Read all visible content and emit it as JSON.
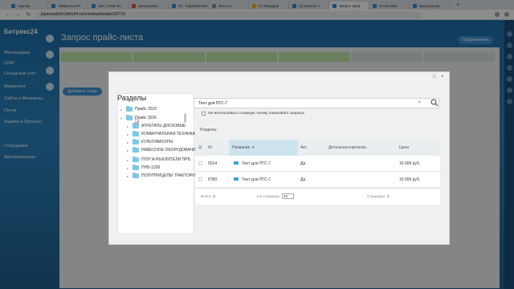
{
  "browser": {
    "tabs": [
      {
        "label": "Сделки",
        "color": "#2f8ad3"
      },
      {
        "label": "Тайвеллы НТ",
        "color": "#2f8ad3"
      },
      {
        "label": "Чат | CRM ИТ",
        "color": "#2f8ad3"
      },
      {
        "label": "www.yandex",
        "color": "#e04d3a"
      },
      {
        "label": "24 · helpdesk.bitrix",
        "color": "#2f8ad3"
      },
      {
        "label": "Фото.ru",
        "color": "#8e8e8e"
      },
      {
        "label": "1С:Предпри",
        "color": "#f0b400"
      },
      {
        "label": "(2) Каталог т",
        "color": "#2f8ad3"
      },
      {
        "label": "Запрос прай",
        "color": "#2f8ad3"
      },
      {
        "label": "Почта Mail",
        "color": "#2f8ad3"
      },
      {
        "label": "Виртуальны",
        "color": "#2f8ad3"
      }
    ],
    "active_tab": 8,
    "new_tab": "+",
    "url": "piyarosalvich.bitrix24.ru/crm/deal/details/16772/"
  },
  "app": {
    "logo": "Битрикс24",
    "menu": [
      "Мессенджер",
      "CRM",
      "Складской учёт",
      "Маркетинг",
      "Сайты и Магазины",
      "Почта",
      "Задачи и Проекты",
      "Сотрудники",
      "Автоматизация"
    ],
    "page_title": "Запрос прайс-листа",
    "add_button": "Добавить товар",
    "right_button": "Предложения"
  },
  "dialog": {
    "sections_title": "Разделы",
    "tree": [
      {
        "label": "Прайс 2023",
        "level": 0,
        "expanded": false
      },
      {
        "label": "Прайс 2026",
        "level": 0,
        "expanded": true
      },
      {
        "label": "АГРЕГАТЫ ДИСКОВЫЕ",
        "level": 1,
        "expanded": false
      },
      {
        "label": "КОММУНАЛЬНАЯ ТЕХНИКА",
        "level": 1,
        "expanded": false
      },
      {
        "label": "КУЛЬТИВАТОРЫ",
        "level": 1,
        "expanded": false
      },
      {
        "label": "НАВЕСНОЕ ОБОРУДОВАНИЕ ДЛЯ",
        "level": 1,
        "expanded": false
      },
      {
        "label": "ПЛУГИ-РЫХЛИТЕЛИ ПРБ",
        "level": 1,
        "expanded": false
      },
      {
        "label": "ПНБ-1200",
        "level": 1,
        "expanded": false
      },
      {
        "label": "ПОЛУПРИЦЕПЫ ТРАКТОРНЫЕ",
        "level": 1,
        "expanded": false
      }
    ],
    "search_value": "Тент для ПГС-7",
    "search_clear": "×",
    "checkbox_label": "Не использовать сложную логику поискового запроса",
    "sections_label": "Разделы:",
    "columns": {
      "id": "ID",
      "name": "Название",
      "active": "Акт.",
      "picture": "Детальная картинка",
      "price": "Цена"
    },
    "rows": [
      {
        "id": "5014",
        "name": "Тент для ПГС-7",
        "active": "Да",
        "price": "16 000 руб."
      },
      {
        "id": "6780",
        "name": "Тент для ПГС-7",
        "active": "Да",
        "price": "19 000 руб."
      }
    ],
    "footer": {
      "total_label": "Всего:",
      "total": "2",
      "per_page_label": "На странице:",
      "per_page": "20",
      "pages_label": "Страницы:",
      "page": "1"
    },
    "maximize": "□",
    "close": "×"
  }
}
